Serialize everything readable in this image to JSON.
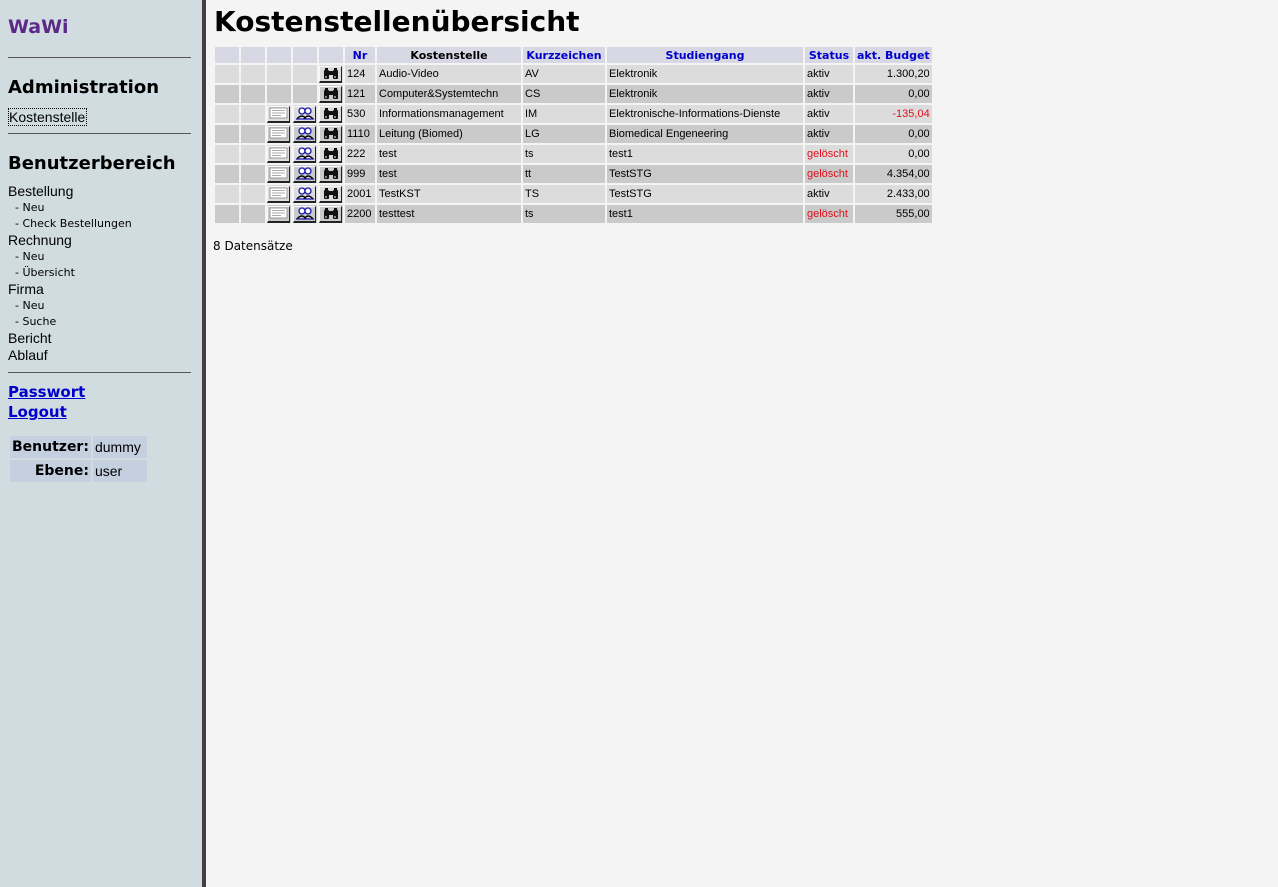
{
  "sidebar": {
    "brand": "WaWi",
    "admin_title": "Administration",
    "admin_link": "Kostenstelle",
    "user_title": "Benutzerbereich",
    "menu": [
      {
        "label": "Bestellung",
        "sub": [
          "- Neu",
          "- Check Bestellungen"
        ]
      },
      {
        "label": "Rechnung",
        "sub": [
          "- Neu",
          "- Übersicht"
        ]
      },
      {
        "label": "Firma",
        "sub": [
          "- Neu",
          "- Suche"
        ]
      },
      {
        "label": "Bericht",
        "sub": []
      },
      {
        "label": "Ablauf",
        "sub": []
      }
    ],
    "password_link": "Passwort",
    "logout_link": "Logout",
    "user_label": "Benutzer:",
    "user_value": "dummy",
    "level_label": "Ebene:",
    "level_value": "user"
  },
  "main": {
    "title": "Kostenstellenübersicht",
    "columns": {
      "nr": "Nr",
      "name": "Kostenstelle",
      "code": "Kurzzeichen",
      "program": "Studiengang",
      "status": "Status",
      "budget": "akt. Budget"
    },
    "rows": [
      {
        "nr": "124",
        "name": "Audio-Video",
        "code": "AV",
        "program": "Elektronik",
        "status": "aktiv",
        "budget": "1.300,20",
        "edit": false
      },
      {
        "nr": "121",
        "name": "Computer&Systemtechn",
        "code": "CS",
        "program": "Elektronik",
        "status": "aktiv",
        "budget": "0,00",
        "edit": false
      },
      {
        "nr": "530",
        "name": "Informationsmanagement",
        "code": "IM",
        "program": "Elektronische-Informations-Dienste",
        "status": "aktiv",
        "budget": "-135,04",
        "edit": true
      },
      {
        "nr": "1110",
        "name": "Leitung (Biomed)",
        "code": "LG",
        "program": "Biomedical Engeneering",
        "status": "aktiv",
        "budget": "0,00",
        "edit": true
      },
      {
        "nr": "222",
        "name": "test",
        "code": "ts",
        "program": "test1",
        "status": "gelöscht",
        "budget": "0,00",
        "edit": true
      },
      {
        "nr": "999",
        "name": "test",
        "code": "tt",
        "program": "TestSTG",
        "status": "gelöscht",
        "budget": "4.354,00",
        "edit": true
      },
      {
        "nr": "2001",
        "name": "TestKST",
        "code": "TS",
        "program": "TestSTG",
        "status": "aktiv",
        "budget": "2.433,00",
        "edit": true
      },
      {
        "nr": "2200",
        "name": "testtest",
        "code": "ts",
        "program": "test1",
        "status": "gelöscht",
        "budget": "555,00",
        "edit": true
      }
    ],
    "record_count": "8 Datensätze",
    "colors": {
      "negative": "#e0101c",
      "deleted": "#e0101c",
      "link": "#0000cc",
      "brand": "#5b2a86"
    }
  }
}
